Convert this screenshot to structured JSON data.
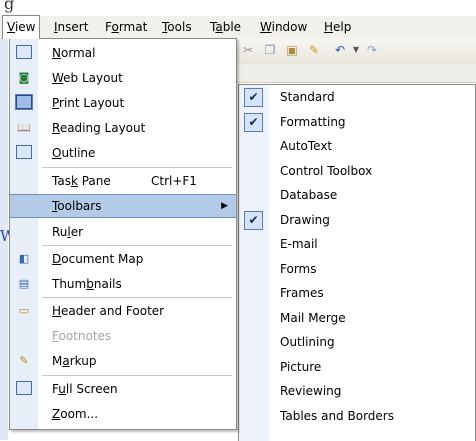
{
  "menubar": {
    "items": [
      {
        "pre": "",
        "ul": "V",
        "post": "iew"
      },
      {
        "pre": "",
        "ul": "I",
        "post": "nsert"
      },
      {
        "pre": "F",
        "ul": "o",
        "post": "rmat"
      },
      {
        "pre": "",
        "ul": "T",
        "post": "ools"
      },
      {
        "pre": "T",
        "ul": "a",
        "post": "ble"
      },
      {
        "pre": "",
        "ul": "W",
        "post": "indow"
      },
      {
        "pre": "",
        "ul": "H",
        "post": "elp"
      }
    ]
  },
  "background_text": {
    "left_letter": "W",
    "top_partial": "g"
  },
  "view_menu": {
    "items": [
      {
        "pre": "",
        "ul": "N",
        "post": "ormal",
        "icon": "normal-view-icon"
      },
      {
        "pre": "",
        "ul": "W",
        "post": "eb Layout",
        "icon": "web-layout-icon"
      },
      {
        "pre": "",
        "ul": "P",
        "post": "rint Layout",
        "icon": "print-layout-icon"
      },
      {
        "pre": "",
        "ul": "R",
        "post": "eading Layout",
        "icon": "reading-layout-icon"
      },
      {
        "pre": "",
        "ul": "O",
        "post": "utline",
        "icon": "outline-view-icon"
      },
      {
        "pre": "Tas",
        "ul": "k",
        "post": " Pane",
        "shortcut": "Ctrl+F1"
      },
      {
        "pre": "",
        "ul": "T",
        "post": "oolbars",
        "submenu": "▶"
      },
      {
        "pre": "Ru",
        "ul": "l",
        "post": "er"
      },
      {
        "pre": "",
        "ul": "D",
        "post": "ocument Map",
        "icon": "document-map-icon"
      },
      {
        "pre": "Thum",
        "ul": "b",
        "post": "nails",
        "icon": "thumbnails-icon"
      },
      {
        "pre": "",
        "ul": "H",
        "post": "eader and Footer",
        "icon": "header-footer-icon"
      },
      {
        "pre": "",
        "ul": "F",
        "post": "ootnotes"
      },
      {
        "pre": "M",
        "ul": "a",
        "post": "rkup",
        "icon": "markup-icon"
      },
      {
        "pre": "F",
        "ul": "u",
        "post": "ll Screen",
        "icon": "full-screen-icon"
      },
      {
        "pre": "",
        "ul": "Z",
        "post": "oom..."
      }
    ]
  },
  "toolbars_submenu": {
    "items": [
      {
        "label": "Standard",
        "checked": true
      },
      {
        "label": "Formatting",
        "checked": true
      },
      {
        "label": "AutoText",
        "checked": false
      },
      {
        "label": "Control Toolbox",
        "checked": false
      },
      {
        "label": "Database",
        "checked": false
      },
      {
        "label": "Drawing",
        "checked": true
      },
      {
        "label": "E-mail",
        "checked": false
      },
      {
        "label": "Forms",
        "checked": false
      },
      {
        "label": "Frames",
        "checked": false
      },
      {
        "label": "Mail Merge",
        "checked": false
      },
      {
        "label": "Outlining",
        "checked": false
      },
      {
        "label": "Picture",
        "checked": false
      },
      {
        "label": "Reviewing",
        "checked": false
      },
      {
        "label": "Tables and Borders",
        "checked": false
      }
    ],
    "check_glyph": "✔"
  },
  "colors": {
    "highlight": "#b3cbe6",
    "gutter": "#e7eef8",
    "disabled_text": "#a6a6a6"
  }
}
